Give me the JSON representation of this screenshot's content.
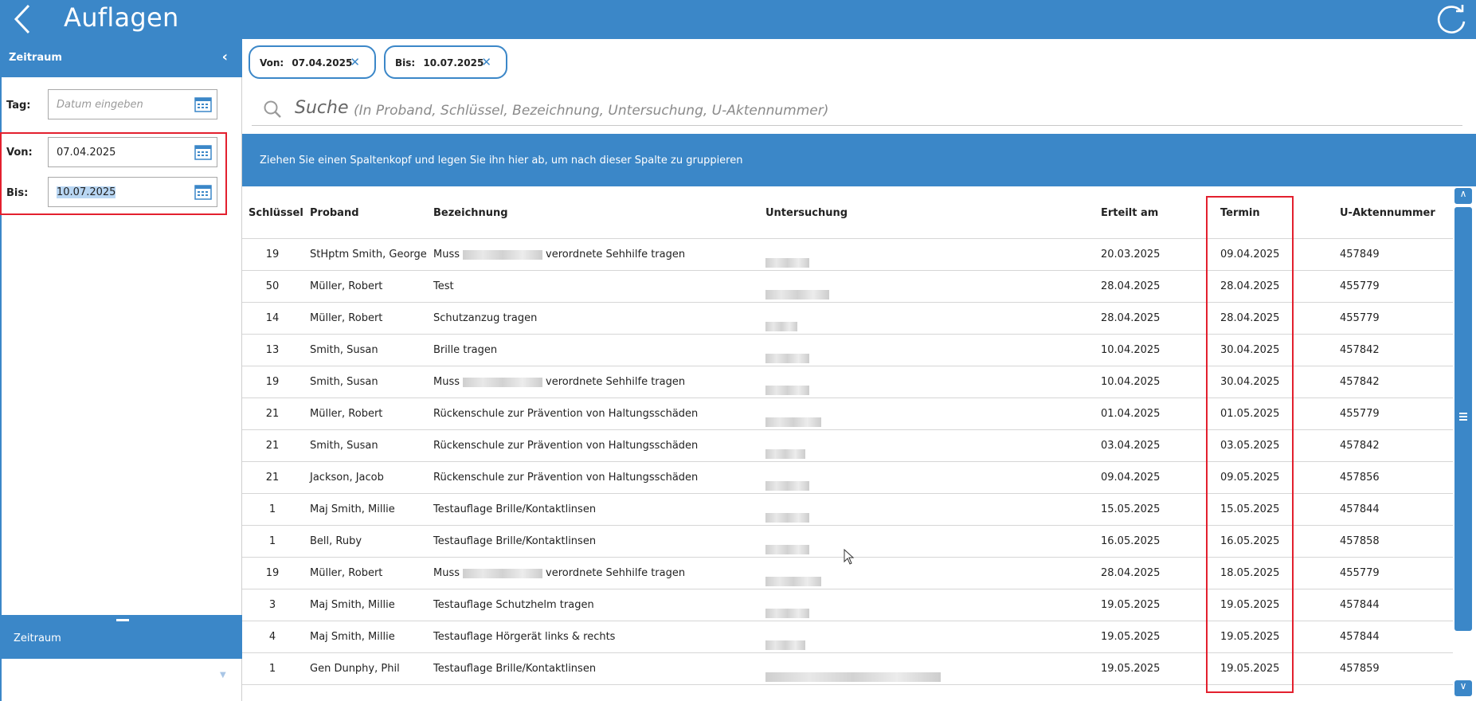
{
  "header": {
    "title": "Auflagen",
    "back_icon": "chevron-left-icon",
    "refresh_icon": "refresh-icon"
  },
  "sidebar": {
    "section_title": "Zeitraum",
    "collapse_icon": "chevron-left-icon",
    "tag": {
      "label": "Tag:",
      "placeholder": "Datum eingeben",
      "value": ""
    },
    "von": {
      "label": "Von:",
      "value": "07.04.2025"
    },
    "bis": {
      "label": "Bis:",
      "value": "10.07.2025"
    },
    "bottom_title": "Zeitraum",
    "expand_icon": "chevron-double-down-icon"
  },
  "filters": [
    {
      "label": "Von:",
      "value": "07.04.2025",
      "remove_icon": "close-icon"
    },
    {
      "label": "Bis:",
      "value": "10.07.2025",
      "remove_icon": "close-icon"
    }
  ],
  "search": {
    "label": "Suche",
    "hint": "(In Proband, Schlüssel, Bezeichnung, Untersuchung, U-Aktennummer)"
  },
  "group_banner": "Ziehen Sie einen Spaltenkopf und legen Sie ihn hier ab, um nach dieser Spalte zu gruppieren",
  "table": {
    "columns": [
      "Schlüssel",
      "Proband",
      "Bezeichnung",
      "Untersuchung",
      "Erteilt am",
      "Termin",
      "U-Aktennummer"
    ],
    "rows": [
      {
        "key": "19",
        "proband": "StHptm Smith, George",
        "bez_a": "Muss",
        "bez_b": "verordnete Sehhilfe tragen",
        "erteilt": "20.03.2025",
        "termin": "09.04.2025",
        "akte": "457849"
      },
      {
        "key": "50",
        "proband": "Müller, Robert",
        "bez_a": "Test",
        "bez_b": "",
        "erteilt": "28.04.2025",
        "termin": "28.04.2025",
        "akte": "455779"
      },
      {
        "key": "14",
        "proband": "Müller, Robert",
        "bez_a": "Schutzanzug tragen",
        "bez_b": "",
        "erteilt": "28.04.2025",
        "termin": "28.04.2025",
        "akte": "455779"
      },
      {
        "key": "13",
        "proband": "Smith, Susan",
        "bez_a": "Brille tragen",
        "bez_b": "",
        "erteilt": "10.04.2025",
        "termin": "30.04.2025",
        "akte": "457842"
      },
      {
        "key": "19",
        "proband": "Smith, Susan",
        "bez_a": "Muss",
        "bez_b": "verordnete Sehhilfe tragen",
        "erteilt": "10.04.2025",
        "termin": "30.04.2025",
        "akte": "457842"
      },
      {
        "key": "21",
        "proband": "Müller, Robert",
        "bez_a": "Rückenschule zur Prävention von Haltungsschäden",
        "bez_b": "",
        "erteilt": "01.04.2025",
        "termin": "01.05.2025",
        "akte": "455779"
      },
      {
        "key": "21",
        "proband": "Smith, Susan",
        "bez_a": "Rückenschule zur Prävention von Haltungsschäden",
        "bez_b": "",
        "erteilt": "03.04.2025",
        "termin": "03.05.2025",
        "akte": "457842"
      },
      {
        "key": "21",
        "proband": "Jackson, Jacob",
        "bez_a": "Rückenschule zur Prävention von Haltungsschäden",
        "bez_b": "",
        "erteilt": "09.04.2025",
        "termin": "09.05.2025",
        "akte": "457856"
      },
      {
        "key": "1",
        "proband": "Maj Smith, Millie",
        "bez_a": "Testauflage Brille/Kontaktlinsen",
        "bez_b": "",
        "erteilt": "15.05.2025",
        "termin": "15.05.2025",
        "akte": "457844"
      },
      {
        "key": "1",
        "proband": "Bell, Ruby",
        "bez_a": "Testauflage Brille/Kontaktlinsen",
        "bez_b": "",
        "erteilt": "16.05.2025",
        "termin": "16.05.2025",
        "akte": "457858"
      },
      {
        "key": "19",
        "proband": "Müller, Robert",
        "bez_a": "Muss",
        "bez_b": "verordnete Sehhilfe tragen",
        "erteilt": "28.04.2025",
        "termin": "18.05.2025",
        "akte": "455779"
      },
      {
        "key": "3",
        "proband": "Maj Smith, Millie",
        "bez_a": "Testauflage Schutzhelm tragen",
        "bez_b": "",
        "erteilt": "19.05.2025",
        "termin": "19.05.2025",
        "akte": "457844"
      },
      {
        "key": "4",
        "proband": "Maj Smith, Millie",
        "bez_a": "Testauflage Hörgerät links & rechts",
        "bez_b": "",
        "erteilt": "19.05.2025",
        "termin": "19.05.2025",
        "akte": "457844"
      },
      {
        "key": "1",
        "proband": "Gen Dunphy, Phil",
        "bez_a": "Testauflage Brille/Kontaktlinsen",
        "bez_b": "",
        "erteilt": "19.05.2025",
        "termin": "19.05.2025",
        "akte": "457859"
      }
    ]
  },
  "scrollbar": {
    "up_icon": "chevron-up-icon",
    "down_icon": "chevron-down-icon"
  },
  "colors": {
    "accent": "#3b87c8",
    "highlight": "#e3202e",
    "selection": "#b8d6f3"
  }
}
